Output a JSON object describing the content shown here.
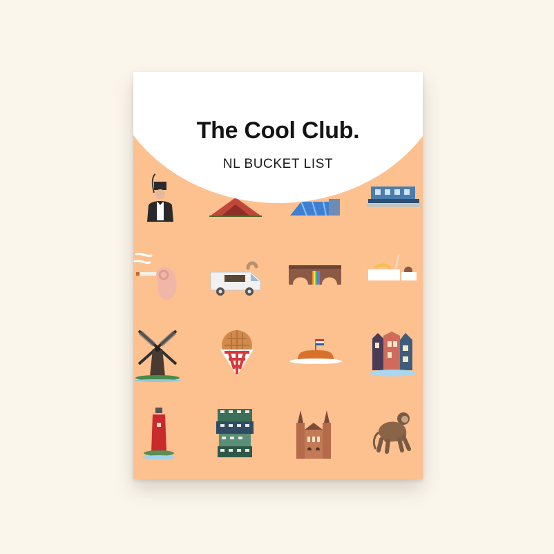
{
  "cover": {
    "title": "The Cool Club.",
    "subtitle": "NL BUCKET LIST"
  },
  "colors": {
    "background": "#fbf6ec",
    "cover": "#fdc08f",
    "header": "#ffffff"
  },
  "icons": [
    "dutch-soldier-icon",
    "tent-hill-icon",
    "blue-building-icon",
    "houseboat-icon",
    "joint-hand-icon",
    "food-truck-icon",
    "rainbow-bridge-icon",
    "fries-trays-icon",
    "windmill-icon",
    "stroopwafel-napkin-icon",
    "cake-flag-icon",
    "canal-houses-icon",
    "lighthouse-icon",
    "stacked-houses-icon",
    "rijksmuseum-icon",
    "monkey-icon"
  ]
}
